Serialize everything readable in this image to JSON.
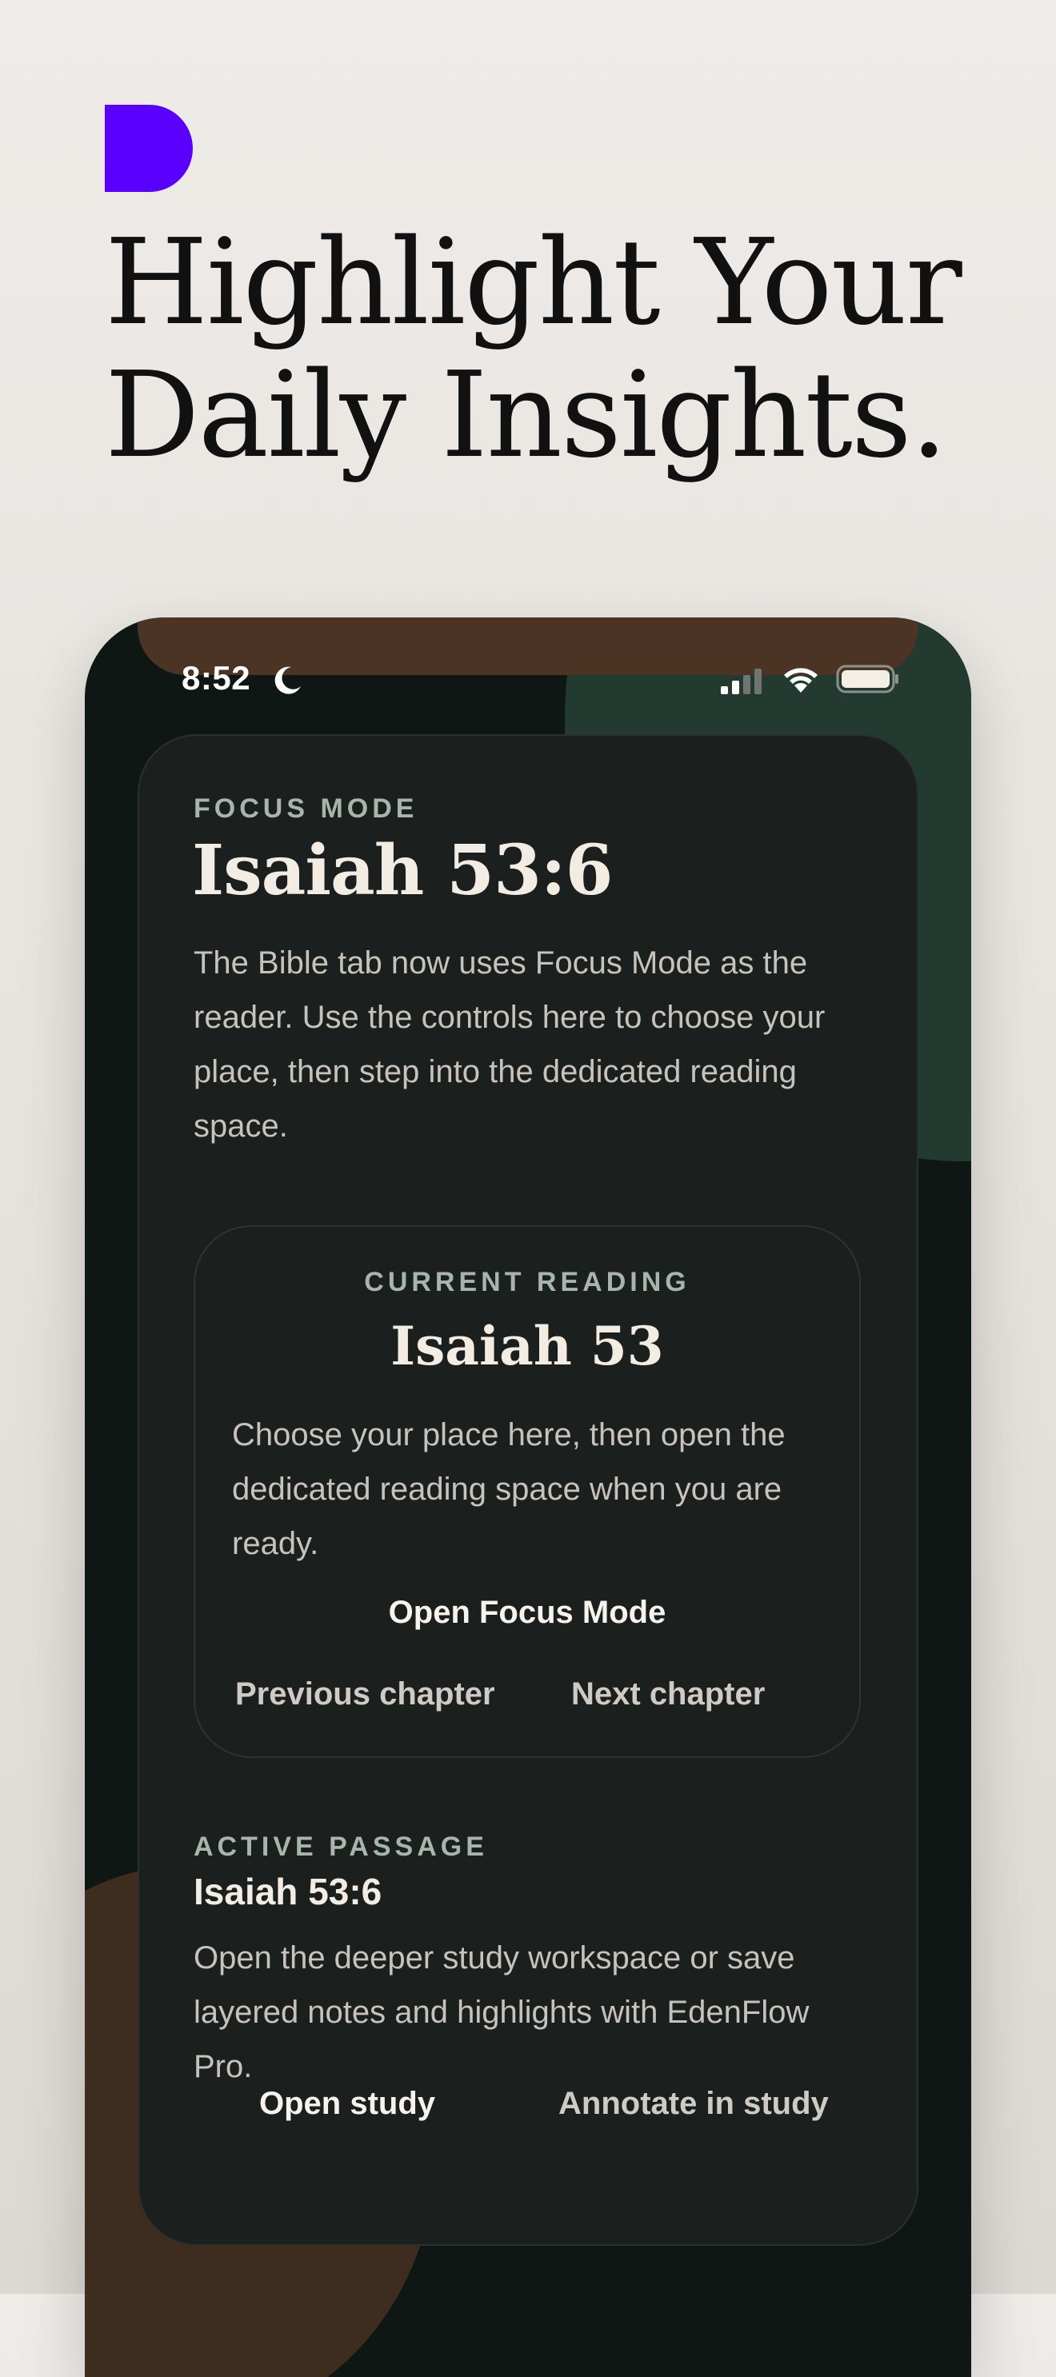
{
  "headline": {
    "line1": "Highlight Your",
    "line2": "Daily Insights."
  },
  "colors": {
    "brand": "#5a00ff",
    "phone_bg": "#0f1714",
    "card_bg": "#1b201e",
    "accent_green": "#223a30",
    "accent_brown": "#4b3423"
  },
  "status_bar": {
    "time": "8:52",
    "icons": [
      "moon-icon",
      "cellular-signal-icon",
      "wifi-icon",
      "battery-icon"
    ]
  },
  "focus_mode": {
    "eyebrow": "FOCUS MODE",
    "title": "Isaiah 53:6",
    "body": "The Bible tab now uses Focus Mode as the reader. Use the controls here to choose your place, then step into the dedicated reading space."
  },
  "current_reading": {
    "eyebrow": "CURRENT READING",
    "title": "Isaiah 53",
    "body": "Choose your place here, then open the dedicated reading space when you are ready.",
    "open_label": "Open Focus Mode",
    "previous_label": "Previous chapter",
    "next_label": "Next chapter"
  },
  "active_passage": {
    "eyebrow": "ACTIVE PASSAGE",
    "title": "Isaiah 53:6",
    "body": "Open the deeper study workspace or save layered notes and highlights with EdenFlow Pro.",
    "open_study_label": "Open study",
    "annotate_label": "Annotate in study"
  }
}
